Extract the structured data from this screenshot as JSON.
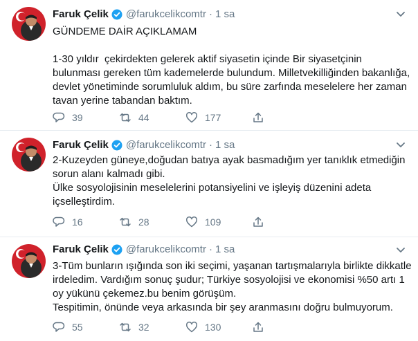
{
  "tweets": [
    {
      "author_name": "Faruk Çelik",
      "handle": "@farukcelikcomtr",
      "separator": "·",
      "time": "1 sa",
      "text": "GÜNDEME DAİR AÇIKLAMAM\n\n1-30 yıldır  çekirdekten gelerek aktif siyasetin içinde Bir siyasetçinin bulunması gereken tüm kademelerde bulundum. Milletvekilliğinden bakanlığa, devlet yönetiminde sorumluluk aldım, bu süre zarfında meselelere her zaman  tavan yerine tabandan baktım.",
      "replies": "39",
      "retweets": "44",
      "likes": "177"
    },
    {
      "author_name": "Faruk Çelik",
      "handle": "@farukcelikcomtr",
      "separator": "·",
      "time": "1 sa",
      "text": "2-Kuzeyden güneye,doğudan batıya ayak basmadığım yer tanıklık etmediğin sorun alanı kalmadı gibi.\nÜlke sosyolojisinin meselelerini potansiyelini ve işleyiş düzenini adeta içselleştirdim.",
      "replies": "16",
      "retweets": "28",
      "likes": "109"
    },
    {
      "author_name": "Faruk Çelik",
      "handle": "@farukcelikcomtr",
      "separator": "·",
      "time": "1 sa",
      "text": "3-Tüm bunların ışığında son iki seçimi, yaşanan tartışmalarıyla birlikte dikkatle irdeledim. Vardığım sonuç şudur; Türkiye sosyolojisi ve ekonomisi %50 artı 1 oy yükünü çekemez.bu benim görüşüm.\nTespitimin, önünde veya arkasında bir şey aranmasını doğru bulmuyorum.",
      "replies": "55",
      "retweets": "32",
      "likes": "130"
    }
  ],
  "colors": {
    "text": "#14171a",
    "secondary": "#657786",
    "verified": "#1da1f2",
    "border": "#e6ecf0"
  },
  "icons": {
    "avatar": "turkish-flag-avatar",
    "verified": "verified-badge-icon",
    "caret": "chevron-down-icon",
    "reply": "reply-icon",
    "retweet": "retweet-icon",
    "like": "heart-icon",
    "share": "share-icon"
  }
}
